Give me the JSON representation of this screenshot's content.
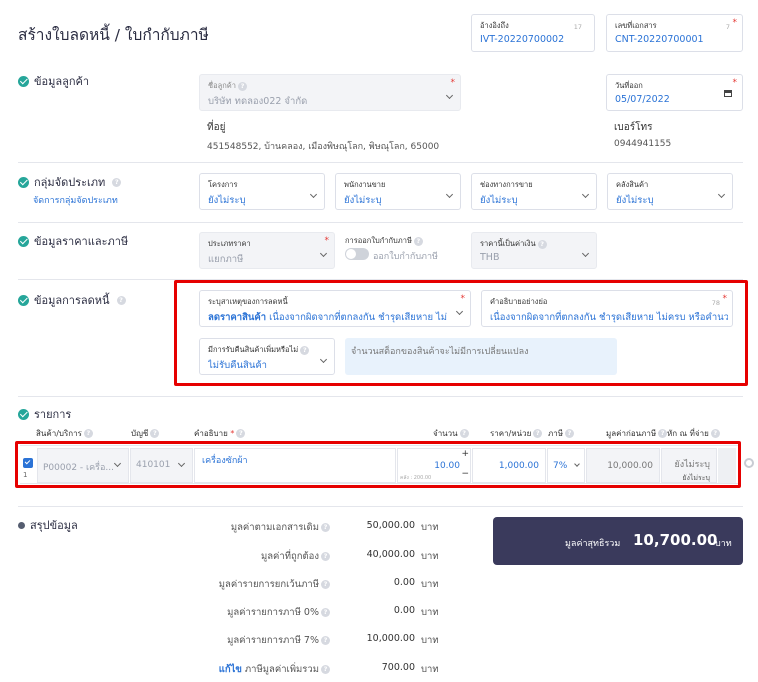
{
  "header": {
    "title": "สร้างใบลดหนี้ / ใบกำกับภาษี",
    "ref_label": "อ้างอิงถึง",
    "ref_value": "IVT-20220700002",
    "ref_counter": "17",
    "doc_label": "เลขที่เอกสาร",
    "doc_value": "CNT-20220700001",
    "doc_counter": "7"
  },
  "customer": {
    "section": "ข้อมูลลูกค้า",
    "name_label": "ชื่อลูกค้า",
    "name_value": "บริษัท ทดลอง022 จำกัด",
    "date_label": "วันที่ออก",
    "date_value": "05/07/2022",
    "address_label": "ที่อยู่",
    "address_value": "451548552, บ้านคลอง, เมืองพิษณุโลก, พิษณุโลก, 65000",
    "phone_label": "เบอร์โทร",
    "phone_value": "0944941155"
  },
  "group": {
    "section": "กลุ่มจัดประเภท",
    "manage_link": "จัดการกลุ่มจัดประเภท",
    "fields": [
      {
        "label": "โครงการ",
        "value": "ยังไม่ระบุ"
      },
      {
        "label": "พนักงานขาย",
        "value": "ยังไม่ระบุ"
      },
      {
        "label": "ช่องทางการขาย",
        "value": "ยังไม่ระบุ"
      },
      {
        "label": "คลังสินค้า",
        "value": "ยังไม่ระบุ"
      }
    ]
  },
  "price": {
    "section": "ข้อมูลราคาและภาษี",
    "type_label": "ประเภทราคา",
    "type_value": "แยกภาษี",
    "tax_invoice_label": "การออกใบกำกับภาษี",
    "tax_invoice_toggle": "ออกใบกำกับภาษี",
    "currency_label": "ราคานี้เป็นค่าเงิน",
    "currency_value": "THB"
  },
  "credit": {
    "section": "ข้อมูลการลดหนี้",
    "reason_label": "ระบุสาเหตุของการลดหนี้",
    "reason_bold": "ลดราคาสินค้า",
    "reason_value": "เนื่องจากผิดจากที่ตกลงกัน ชำรุดเสียหาย ไม่...",
    "desc_label": "คำอธิบายอย่างย่อ",
    "desc_counter": "78",
    "desc_value": "เนื่องจากผิดจากที่ตกลงกัน ชำรุดเสียหาย ไม่ครบ หรือคำนวณ",
    "return_label": "มีการรับคืนสินค้าเพิ่มหรือไม่",
    "return_value": "ไม่รับคืนสินค้า",
    "stock_note": "จำนวนสต็อกของสินค้าจะไม่มีการเปลี่ยนแปลง"
  },
  "items": {
    "section": "รายการ",
    "headers": {
      "product": "สินค้า/บริการ",
      "account": "บัญชี",
      "description": "คำอธิบาย",
      "qty": "จำนวน",
      "unit_price": "ราคา/หน่วย",
      "tax": "ภาษี",
      "pre_tax": "มูลค่าก่อนภาษี",
      "withholding": "หัก ณ ที่จ่าย"
    },
    "row": {
      "index": "1",
      "product": "P00002 - เครื่อ...",
      "account": "410101",
      "description": "เครื่องซักผ้า",
      "qty": "10.00",
      "qty_note": "คลัง : 200.00",
      "unit_price": "1,000.00",
      "tax": "7%",
      "pre_tax": "10,000.00",
      "withholding": "ยังไม่ระบุ",
      "withholding_sub": "ยังไม่ระบุ"
    }
  },
  "summary": {
    "section": "สรุปข้อมูล",
    "rows": [
      {
        "label": "มูลค่าตามเอกสารเดิม",
        "value": "50,000.00",
        "unit": "บาท"
      },
      {
        "label": "มูลค่าที่ถูกต้อง",
        "value": "40,000.00",
        "unit": "บาท"
      },
      {
        "label": "มูลค่ารายการยกเว้นภาษี",
        "value": "0.00",
        "unit": "บาท"
      },
      {
        "label": "มูลค่ารายการภาษี 0%",
        "value": "0.00",
        "unit": "บาท"
      },
      {
        "label": "มูลค่ารายการภาษี 7%",
        "value": "10,000.00",
        "unit": "บาท"
      },
      {
        "label": "ภาษีมูลค่าเพิ่มรวม",
        "value": "700.00",
        "unit": "บาท",
        "link": "แก้ไข"
      }
    ],
    "net_label": "มูลค่าสุทธิรวม",
    "net_value": "10,700.00",
    "net_unit": "บาท"
  },
  "colors": {
    "accent": "#2b73d6",
    "check": "#26a69a",
    "highlight": "#e60000",
    "net_bg": "#3a3a5c"
  }
}
